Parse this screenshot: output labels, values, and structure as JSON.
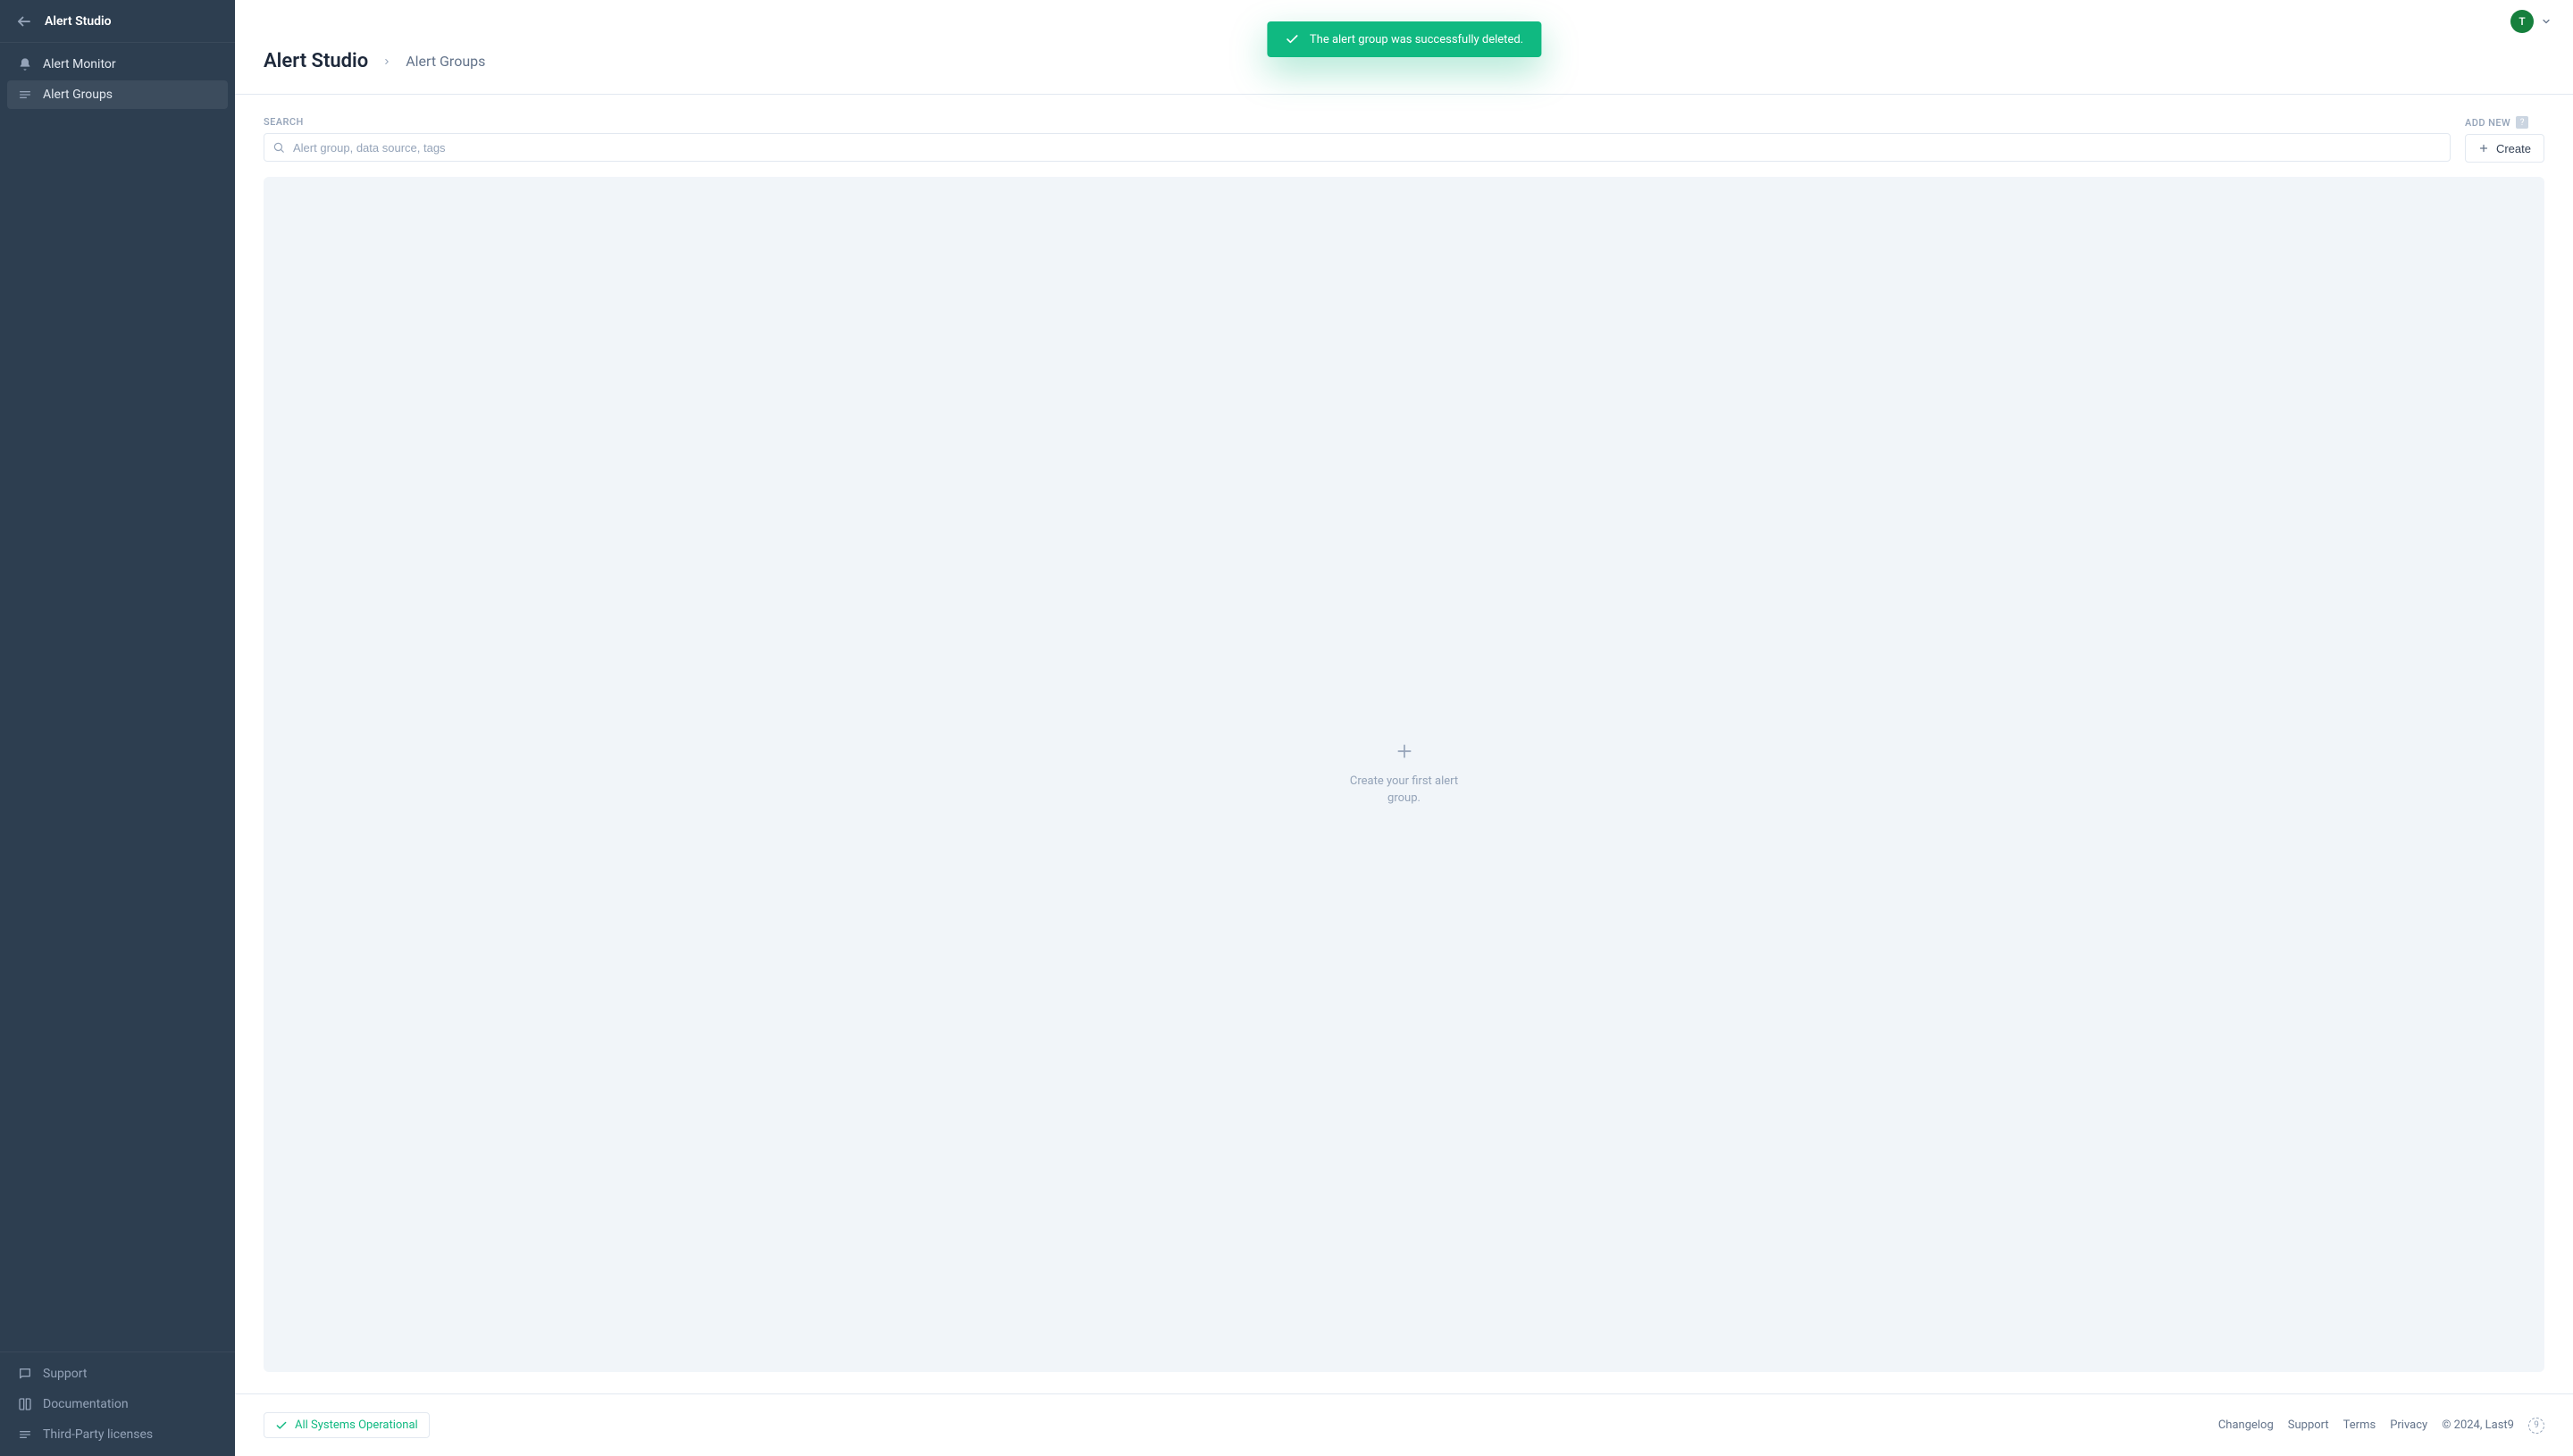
{
  "sidebar": {
    "title": "Alert Studio",
    "nav": [
      {
        "label": "Alert Monitor",
        "id": "alert-monitor",
        "active": false,
        "icon": "bell-icon"
      },
      {
        "label": "Alert Groups",
        "id": "alert-groups",
        "active": true,
        "icon": "list-icon"
      }
    ],
    "footer": [
      {
        "label": "Support",
        "id": "support",
        "icon": "chat-icon"
      },
      {
        "label": "Documentation",
        "id": "documentation",
        "icon": "book-icon"
      },
      {
        "label": "Third-Party licenses",
        "id": "third-party-licenses",
        "icon": "list-icon"
      }
    ]
  },
  "topbar": {
    "avatar_initial": "T"
  },
  "breadcrumb": {
    "root": "Alert Studio",
    "leaf": "Alert Groups"
  },
  "controls": {
    "search_label": "SEARCH",
    "search_placeholder": "Alert group, data source, tags",
    "add_new_label": "ADD NEW",
    "help_badge": "?",
    "create_label": "Create"
  },
  "empty_state": {
    "text": "Create your first alert group."
  },
  "toast": {
    "message": "The alert group was successfully deleted."
  },
  "footer": {
    "status": "All Systems Operational",
    "links": [
      "Changelog",
      "Support",
      "Terms",
      "Privacy"
    ],
    "copyright": "© 2024, Last9",
    "logo_char": "9"
  }
}
